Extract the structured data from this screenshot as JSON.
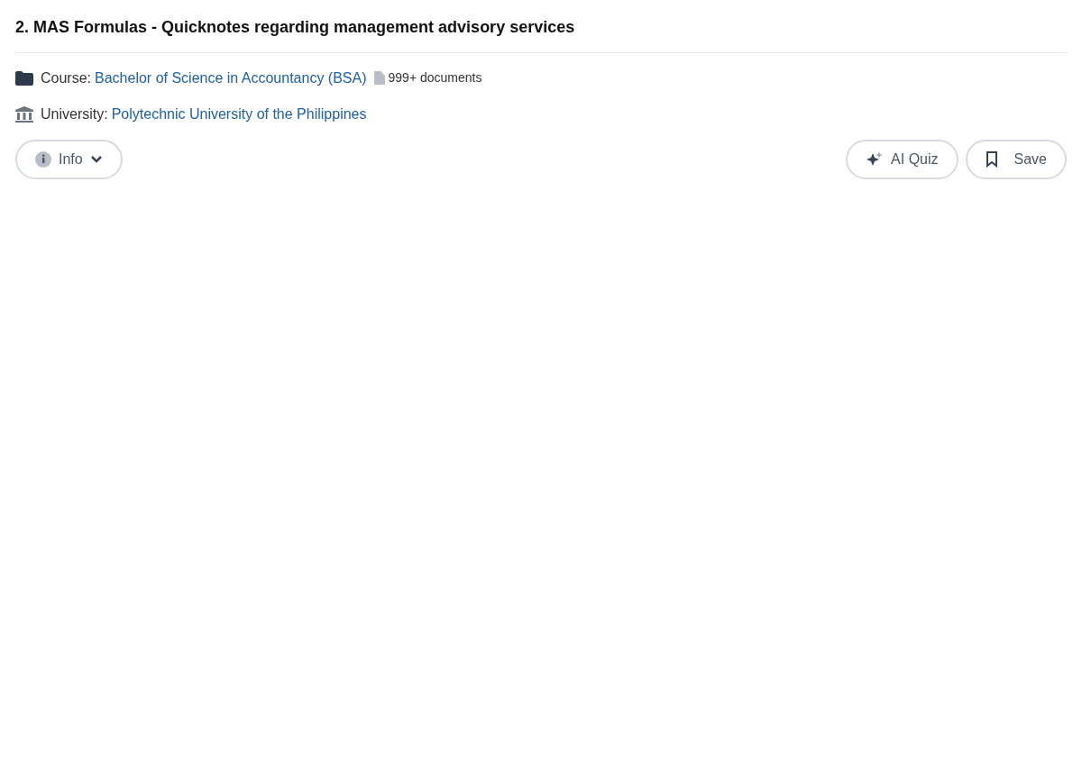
{
  "title": "2. MAS Formulas - Quicknotes regarding management advisory services",
  "course": {
    "label": "Course:",
    "link": "Bachelor of Science in Accountancy (BSA)",
    "count": "999+ documents"
  },
  "university": {
    "label": "University:",
    "link": "Polytechnic University of the Philippines"
  },
  "buttons": [
    {
      "label": "Info",
      "kind": "info"
    },
    {
      "label": "AI Quiz",
      "kind": "quiz"
    },
    {
      "label": "Save",
      "kind": "save"
    }
  ]
}
